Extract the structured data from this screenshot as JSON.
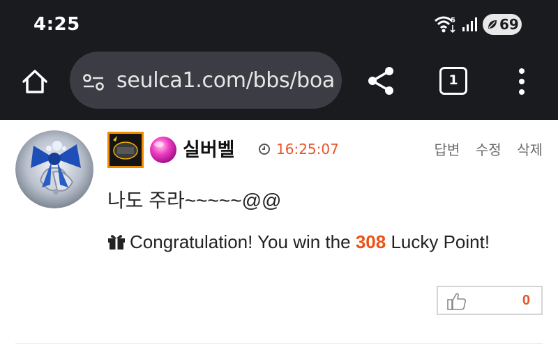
{
  "status_bar": {
    "time": "4:25",
    "battery": "69",
    "wifi_badge": "5"
  },
  "browser": {
    "url": "seulca1.com/bbs/boa",
    "tab_count": "1"
  },
  "comment": {
    "author": "실버벨",
    "time": "16:25:07",
    "actions": {
      "reply": "답변",
      "edit": "수정",
      "delete": "삭제"
    },
    "text": "나도 주라~~~~~@@",
    "reward": {
      "prefix": "Congratulation! You win the",
      "points": "308",
      "suffix": "Lucky Point!"
    },
    "like_count": "0"
  },
  "colors": {
    "bar_bg": "#1a1b1f",
    "url_pill": "#3c3d44",
    "accent": "#e8542a",
    "avatar_ribbon": "#1e4fb8"
  }
}
